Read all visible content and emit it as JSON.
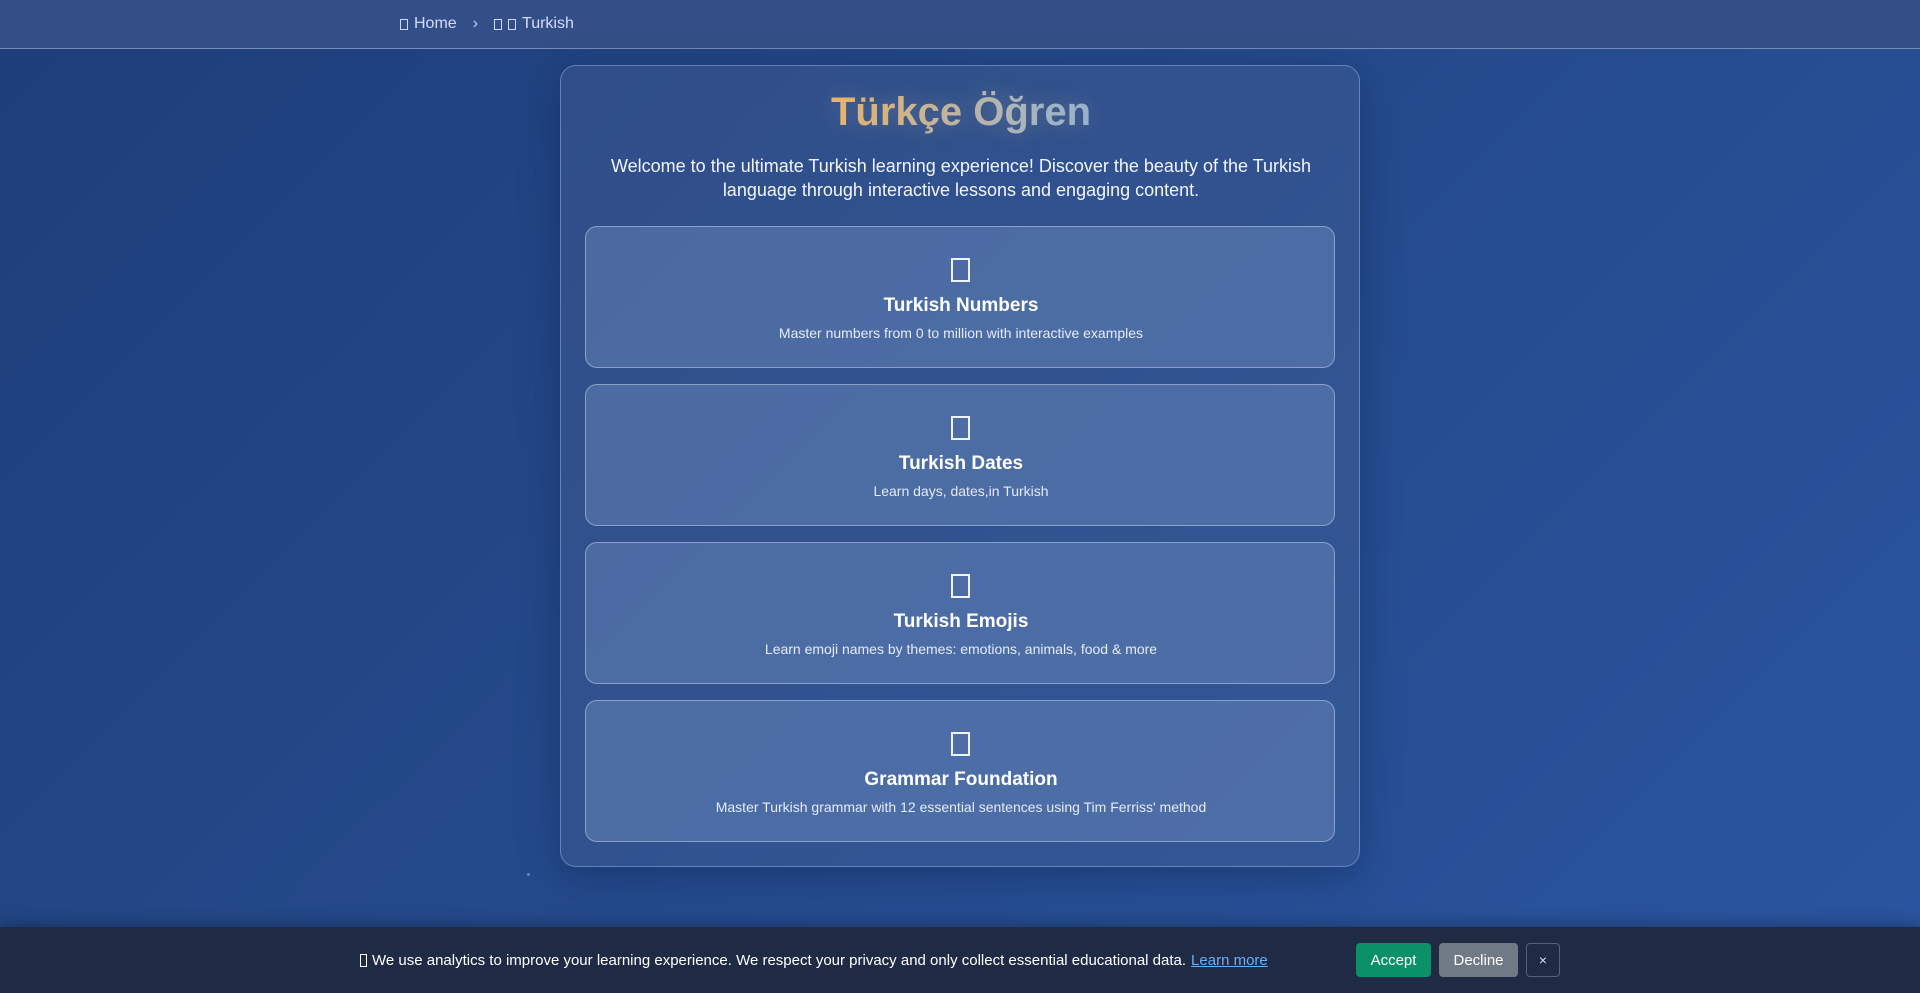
{
  "breadcrumb": {
    "home_label": "Home",
    "separator": "›",
    "current_label": "Turkish"
  },
  "main": {
    "title": "Türkçe Öğren",
    "intro": "Welcome to the ultimate Turkish learning experience! Discover the beauty of the Turkish language through interactive lessons and engaging content."
  },
  "cards": [
    {
      "icon": "numbers-icon",
      "title": "Turkish Numbers",
      "description": "Master numbers from 0 to million with interactive examples"
    },
    {
      "icon": "calendar-icon",
      "title": "Turkish Dates",
      "description": "Learn days, dates,in Turkish"
    },
    {
      "icon": "emoji-icon",
      "title": "Turkish Emojis",
      "description": "Learn emoji names by themes: emotions, animals, food & more"
    },
    {
      "icon": "book-icon",
      "title": "Grammar Foundation",
      "description": "Master Turkish grammar with 12 essential sentences using Tim Ferriss' method"
    }
  ],
  "cookie_banner": {
    "message": "We use analytics to improve your learning experience. We respect your privacy and only collect essential educational data.",
    "learn_more": "Learn more",
    "accept_label": "Accept",
    "decline_label": "Decline",
    "close_label": "×"
  },
  "colors": {
    "background": "#24498a",
    "accept": "#0a9165",
    "decline": "#707a86",
    "link": "#6aaefc"
  }
}
